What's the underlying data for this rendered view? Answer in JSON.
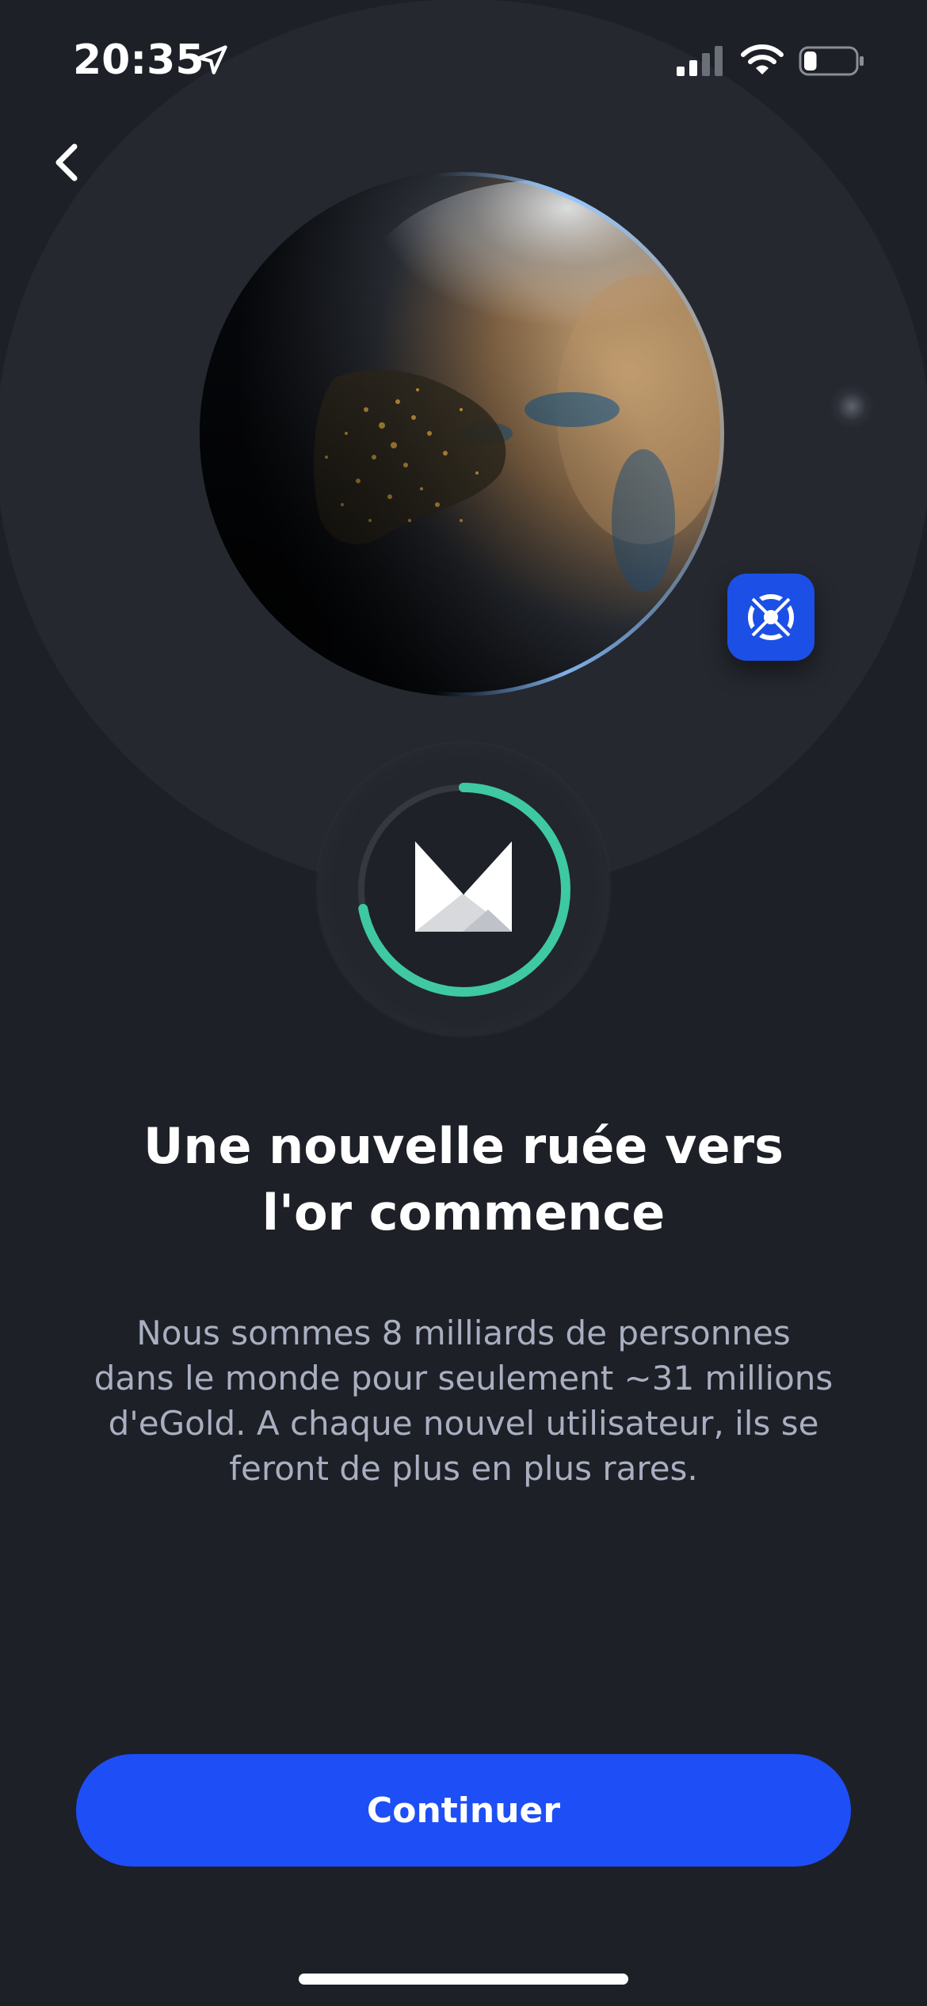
{
  "status_bar": {
    "time": "20:35",
    "location_icon": "location-arrow-icon",
    "signal_icon": "cellular-signal-icon",
    "wifi_icon": "wifi-icon",
    "battery_icon": "battery-icon",
    "battery_level": 0.25
  },
  "navigation": {
    "back_icon": "chevron-left-icon"
  },
  "hero": {
    "globe_image": "earth-at-night-image",
    "badge_icon": "egld-token-icon",
    "progress_ring_value": 0.72,
    "logo_icon": "multiversx-logo-icon"
  },
  "content": {
    "title_line_1": "Une nouvelle ruée vers",
    "title_line_2": "l'or commence",
    "description_line_1": "Nous sommes 8 milliards de personnes",
    "description_line_2": "dans le monde pour seulement ~31 millions",
    "description_line_3": "d'eGold. A chaque nouvel utilisateur, ils se",
    "description_line_4": "feront de plus en plus rares."
  },
  "actions": {
    "continue_label": "Continuer"
  },
  "colors": {
    "background": "#1d2027",
    "accent_blue": "#1e4ef5",
    "progress_green": "#3ec9a2",
    "text_muted": "#a9afc0"
  }
}
